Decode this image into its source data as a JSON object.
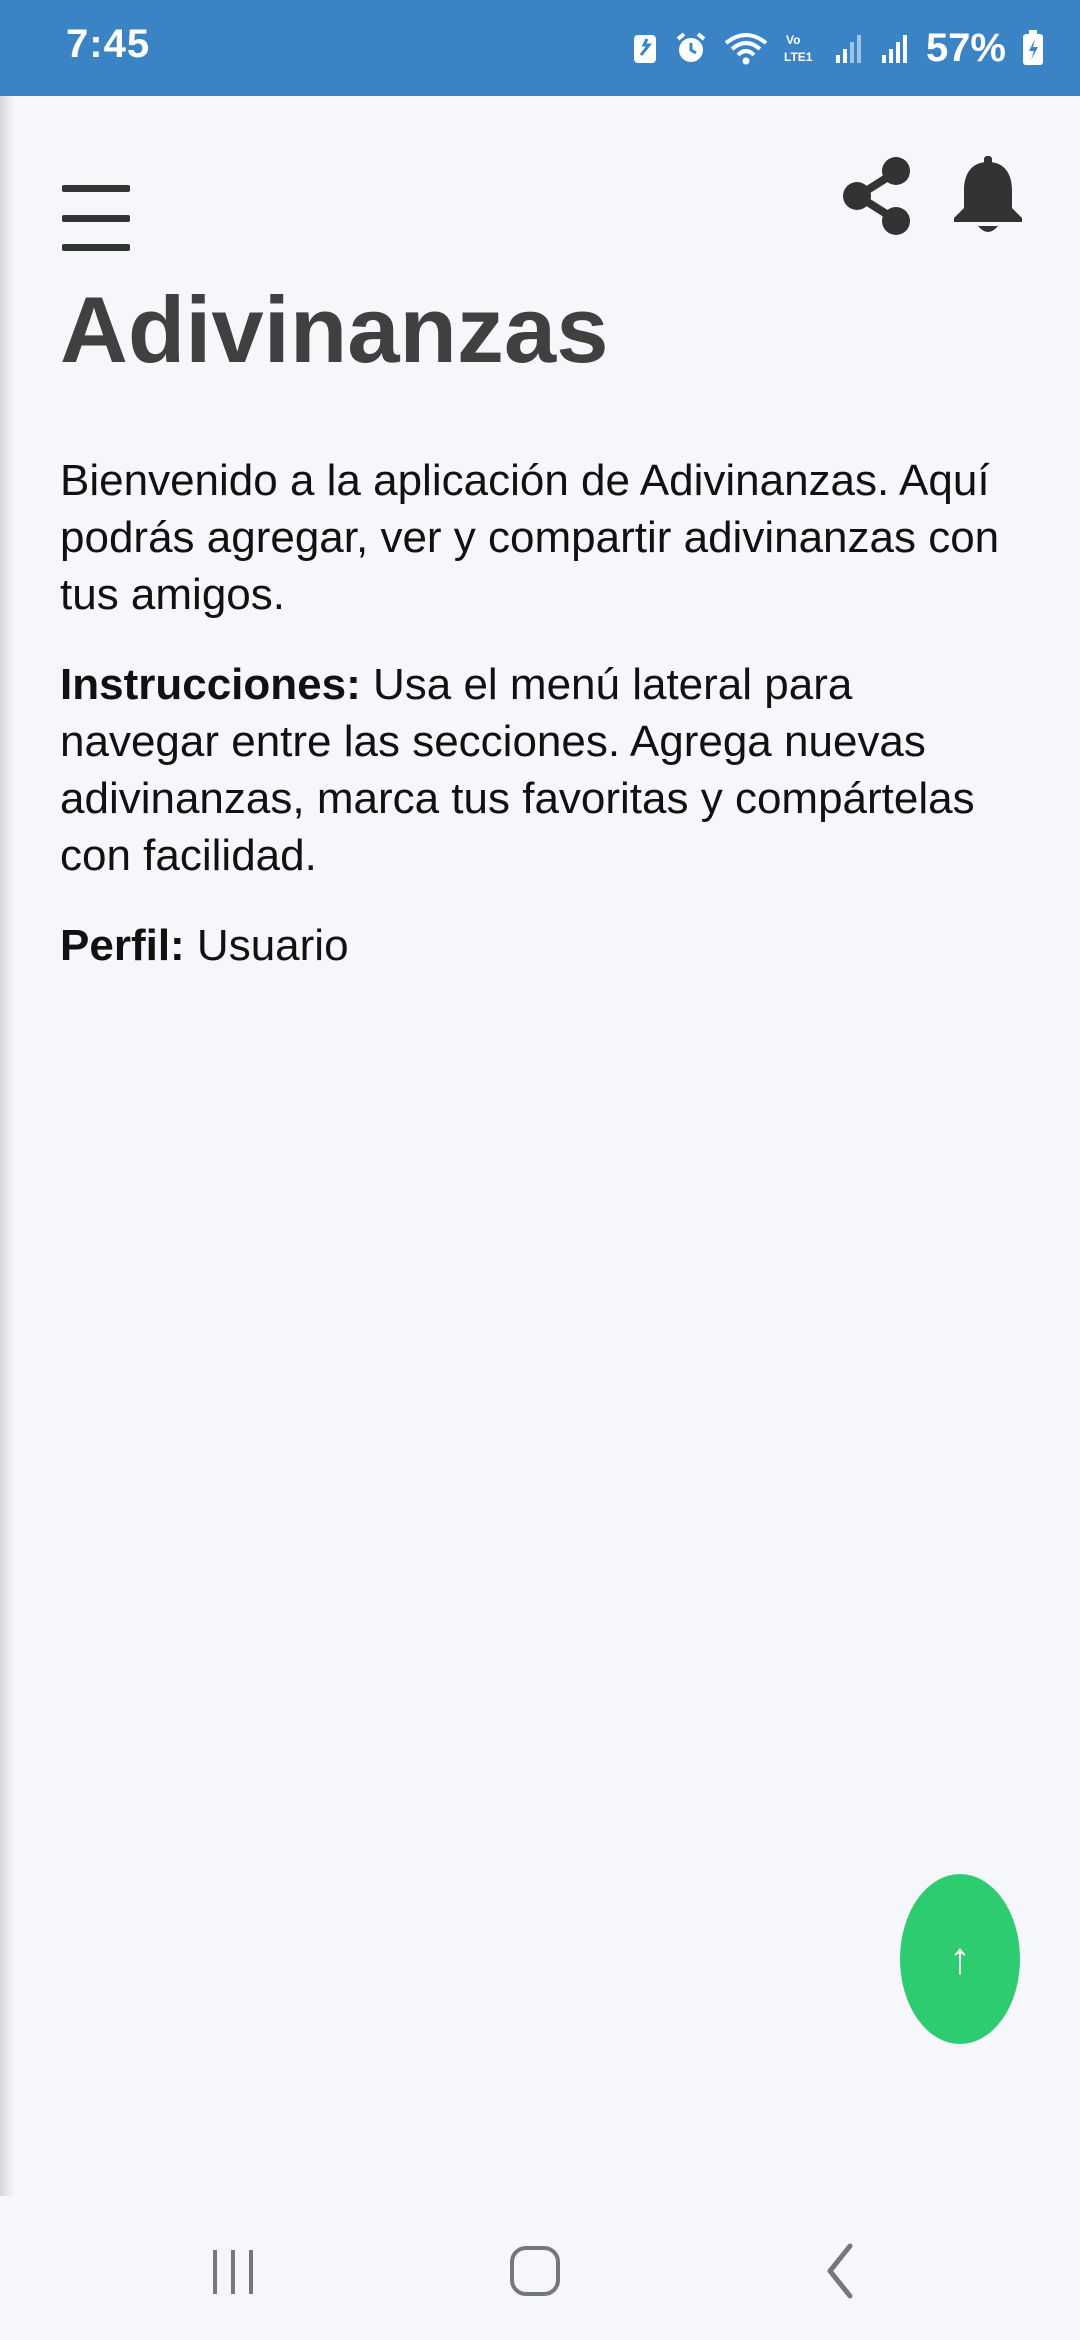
{
  "status_bar": {
    "time": "7:45",
    "battery_percent": "57%",
    "network_label": "Vo LTE1",
    "background_color": "#3a84c6"
  },
  "header": {
    "menu_icon": "menu-icon",
    "share_icon": "share-icon",
    "bell_icon": "bell-icon"
  },
  "page": {
    "title": "Adivinanzas",
    "welcome_text": "Bienvenido a la aplicación de Adivinanzas. Aquí podrás agregar, ver y compartir adivinanzas con tus amigos.",
    "instructions_label": "Instrucciones:",
    "instructions_text": " Usa el menú lateral para navegar entre las secciones. Agrega nuevas adivinanzas, marca tus favoritas y compártelas con facilidad.",
    "profile_label": "Perfil:",
    "profile_value": " Usuario"
  },
  "fab": {
    "label": "↑",
    "color": "#2ecc71"
  },
  "nav_bar": {
    "recent_icon": "recent-apps-icon",
    "home_icon": "home-icon",
    "back_icon": "back-icon"
  }
}
